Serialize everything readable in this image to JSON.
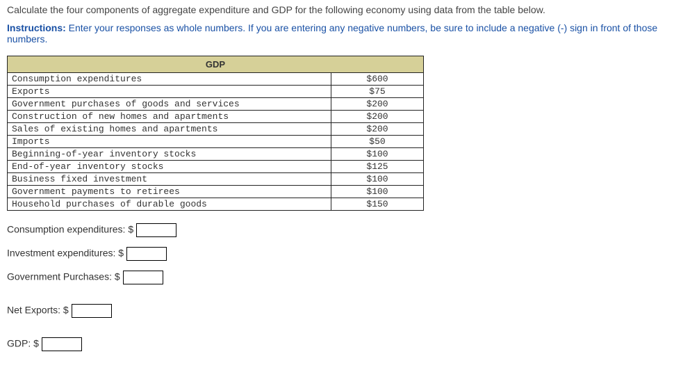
{
  "prompt": "Calculate the four components of aggregate expenditure and GDP for the following economy using data from the table below.",
  "instructions_label": "Instructions:",
  "instructions_text": " Enter your responses as whole numbers. If you are entering any negative numbers, be sure to include a negative (-) sign in front of those numbers.",
  "table": {
    "header": "GDP",
    "rows": [
      {
        "label": "Consumption expenditures",
        "value": "$600"
      },
      {
        "label": "Exports",
        "value": "$75"
      },
      {
        "label": "Government purchases of goods and services",
        "value": "$200"
      },
      {
        "label": "Construction of new homes and apartments",
        "value": "$200"
      },
      {
        "label": "Sales of existing homes and apartments",
        "value": "$200"
      },
      {
        "label": "Imports",
        "value": "$50"
      },
      {
        "label": "Beginning-of-year inventory stocks",
        "value": "$100"
      },
      {
        "label": "End-of-year inventory stocks",
        "value": "$125"
      },
      {
        "label": "Business fixed investment",
        "value": "$100"
      },
      {
        "label": "Government payments to retirees",
        "value": "$100"
      },
      {
        "label": "Household purchases of durable goods",
        "value": "$150"
      }
    ]
  },
  "answers": {
    "consumption_label": "Consumption expenditures: $ ",
    "investment_label": "Investment expenditures: $",
    "government_label": "Government Purchases: $ ",
    "netexports_label": "Net Exports: $ ",
    "gdp_label": "GDP: $"
  }
}
